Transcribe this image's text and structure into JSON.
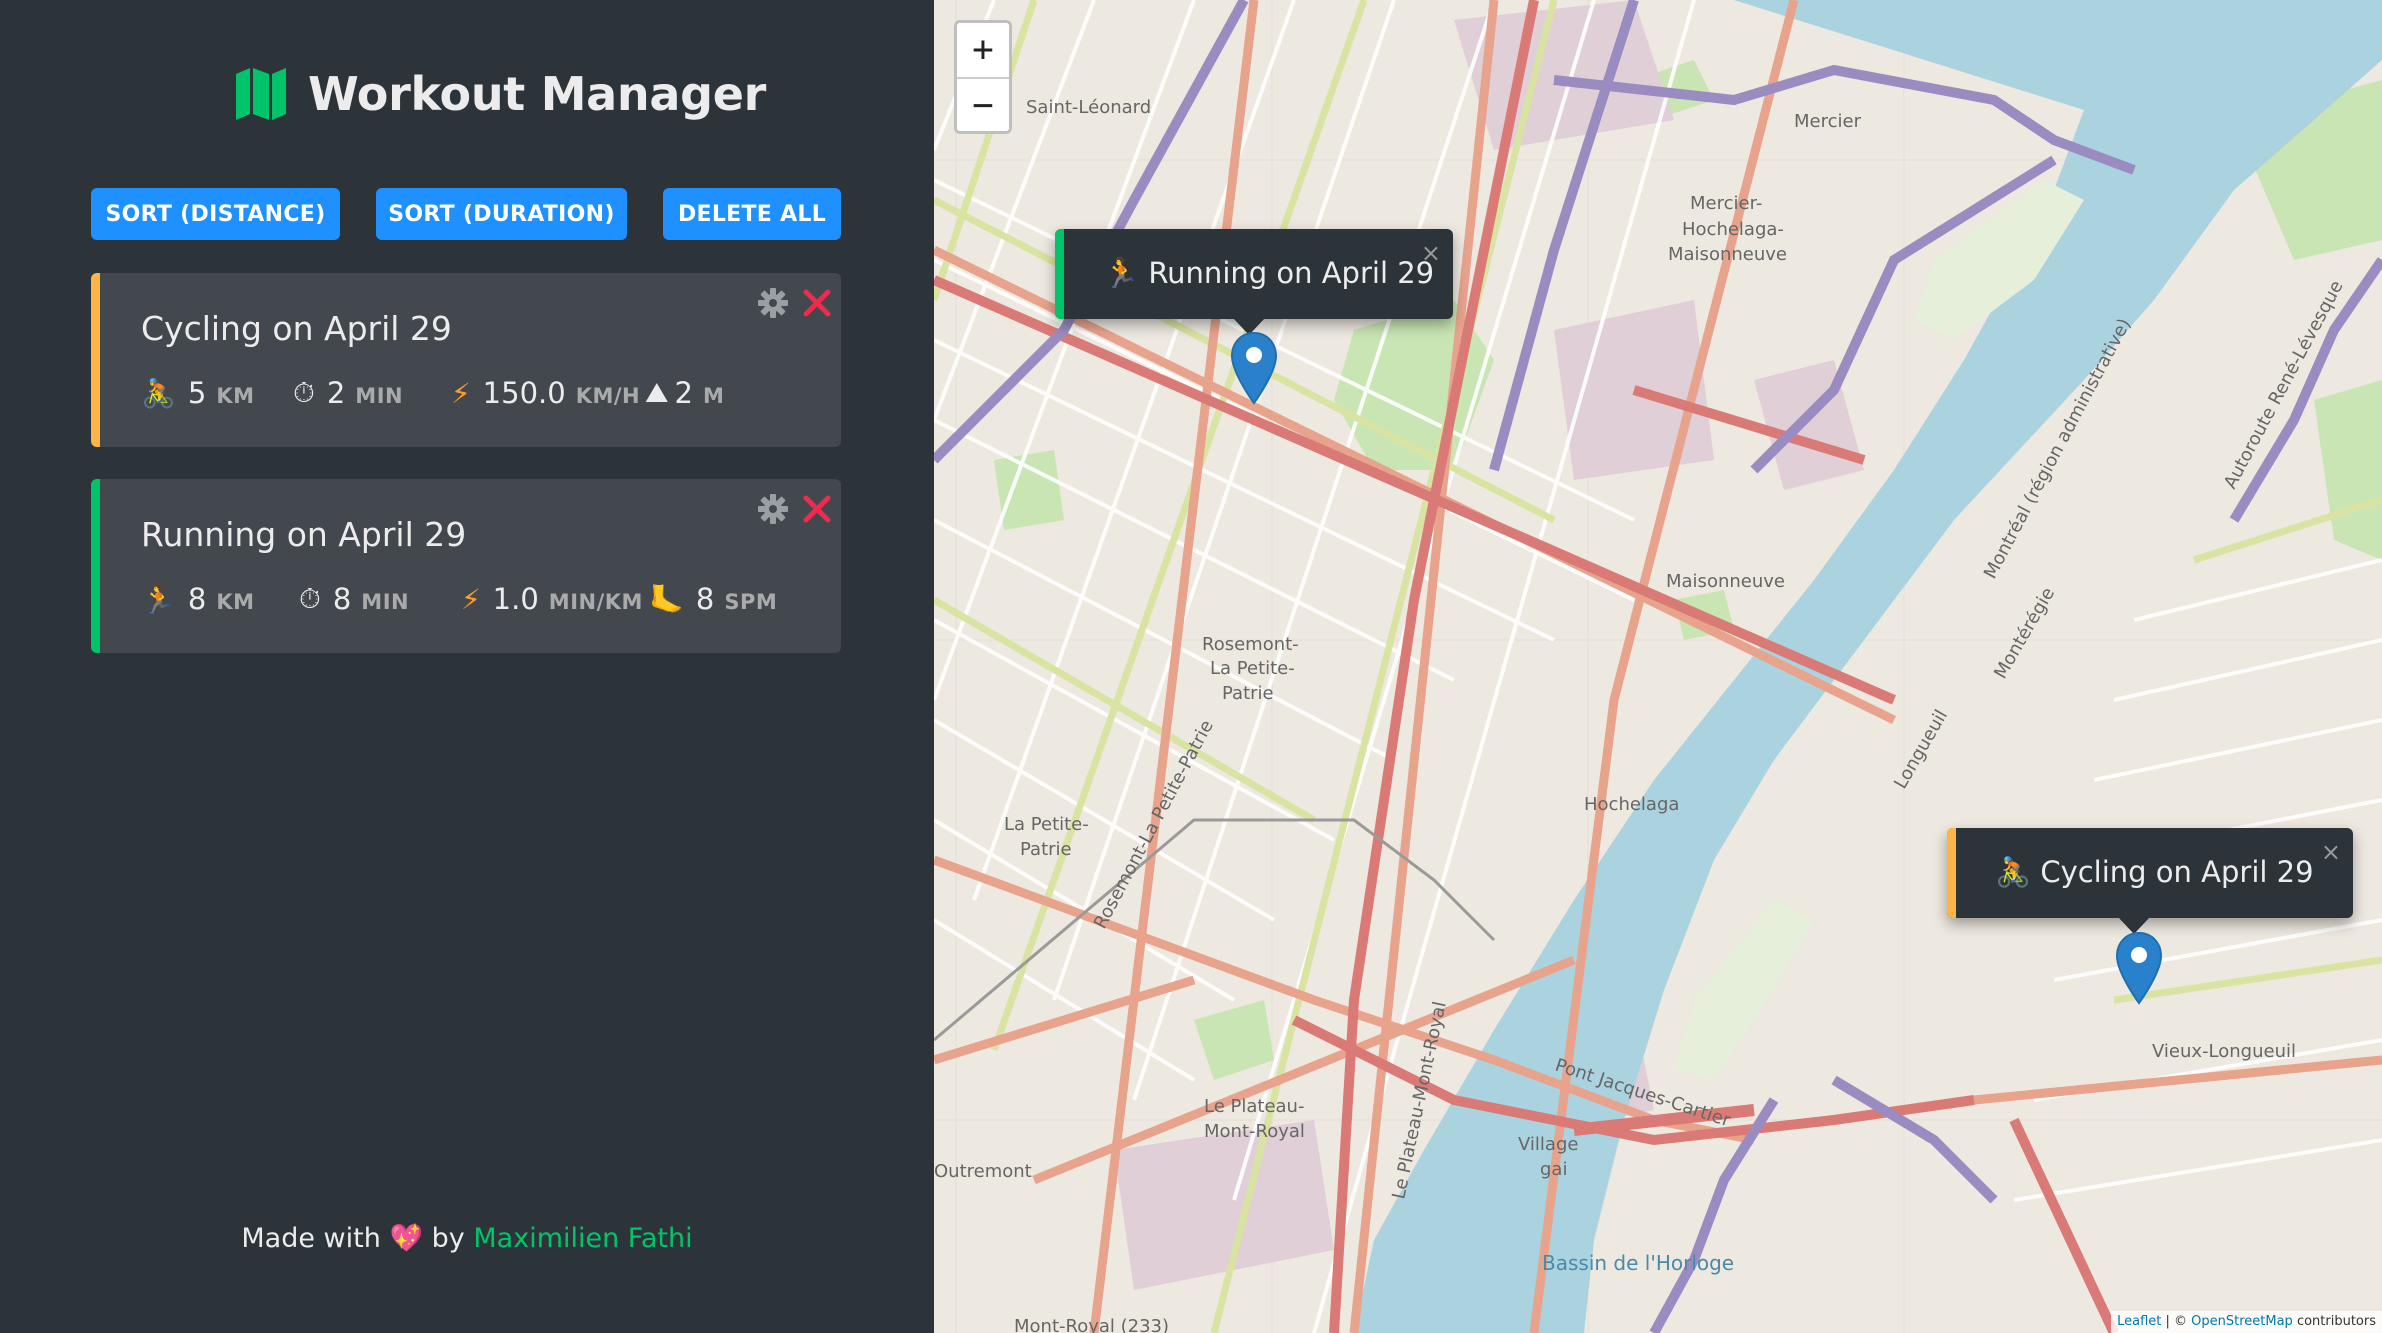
{
  "app": {
    "title": "Workout Manager",
    "brand_color": "#00c46a",
    "icon": "map-icon"
  },
  "toolbar": {
    "sort_distance_label": "SORT (DISTANCE)",
    "sort_duration_label": "SORT (DURATION)",
    "delete_all_label": "DELETE ALL"
  },
  "workouts": [
    {
      "type": "cycling",
      "title": "Cycling on April 29",
      "accent": "#ffb545",
      "details": [
        {
          "icon": "cyclist-icon",
          "glyph": "🚴",
          "value": "5",
          "unit": "KM"
        },
        {
          "icon": "stopwatch-icon",
          "glyph": "⏱",
          "value": "2",
          "unit": "MIN"
        },
        {
          "icon": "lightning-icon",
          "glyph": "⚡",
          "value": "150.0",
          "unit": "KM/H"
        },
        {
          "icon": "mountain-icon",
          "glyph": "⛰",
          "value": "2",
          "unit": "M"
        }
      ]
    },
    {
      "type": "running",
      "title": "Running on April 29",
      "accent": "#00c46a",
      "details": [
        {
          "icon": "runner-icon",
          "glyph": "🏃",
          "value": "8",
          "unit": "KM"
        },
        {
          "icon": "stopwatch-icon",
          "glyph": "⏱",
          "value": "8",
          "unit": "MIN"
        },
        {
          "icon": "lightning-icon",
          "glyph": "⚡",
          "value": "1.0",
          "unit": "MIN/KM"
        },
        {
          "icon": "foot-icon",
          "glyph": "🦶",
          "value": "8",
          "unit": "SPM"
        }
      ]
    }
  ],
  "footer": {
    "prefix": "Made with",
    "heart": "💖",
    "by": "by",
    "author": "Maximilien Fathi"
  },
  "map": {
    "zoom_in": "+",
    "zoom_out": "−",
    "popups": [
      {
        "type": "running",
        "glyph": "🏃",
        "text": "Running on April 29",
        "close": "×"
      },
      {
        "type": "cycling",
        "glyph": "🚴",
        "text": "Cycling on April 29",
        "close": "×"
      }
    ],
    "labels": [
      "Saint-Léonard",
      "Mercier",
      "Mercier-",
      "Hochelaga-",
      "Maisonneuve",
      "Maisonneuve",
      "Rosemont-",
      "La Petite-",
      "Patrie",
      "Hochelaga",
      "La Petite-",
      "Patrie",
      "Le Plateau-",
      "Mont-Royal",
      "Village",
      "gai",
      "Outremont",
      "Vieux-Longueuil",
      "Bassin de l'Horloge",
      "Pont Jacques-Cartier",
      "Le Plateau-Mont-Royal",
      "Mont-Royal (233)",
      "Autoroute René-Lévesque",
      "Rosemont-La Petite-Patrie",
      "Montréal (région administrative)",
      "Longueuil",
      "Montérégie"
    ],
    "attribution": {
      "leaflet": "Leaflet",
      "sep": " | © ",
      "osm": "OpenStreetMap",
      "suffix": " contributors"
    }
  }
}
